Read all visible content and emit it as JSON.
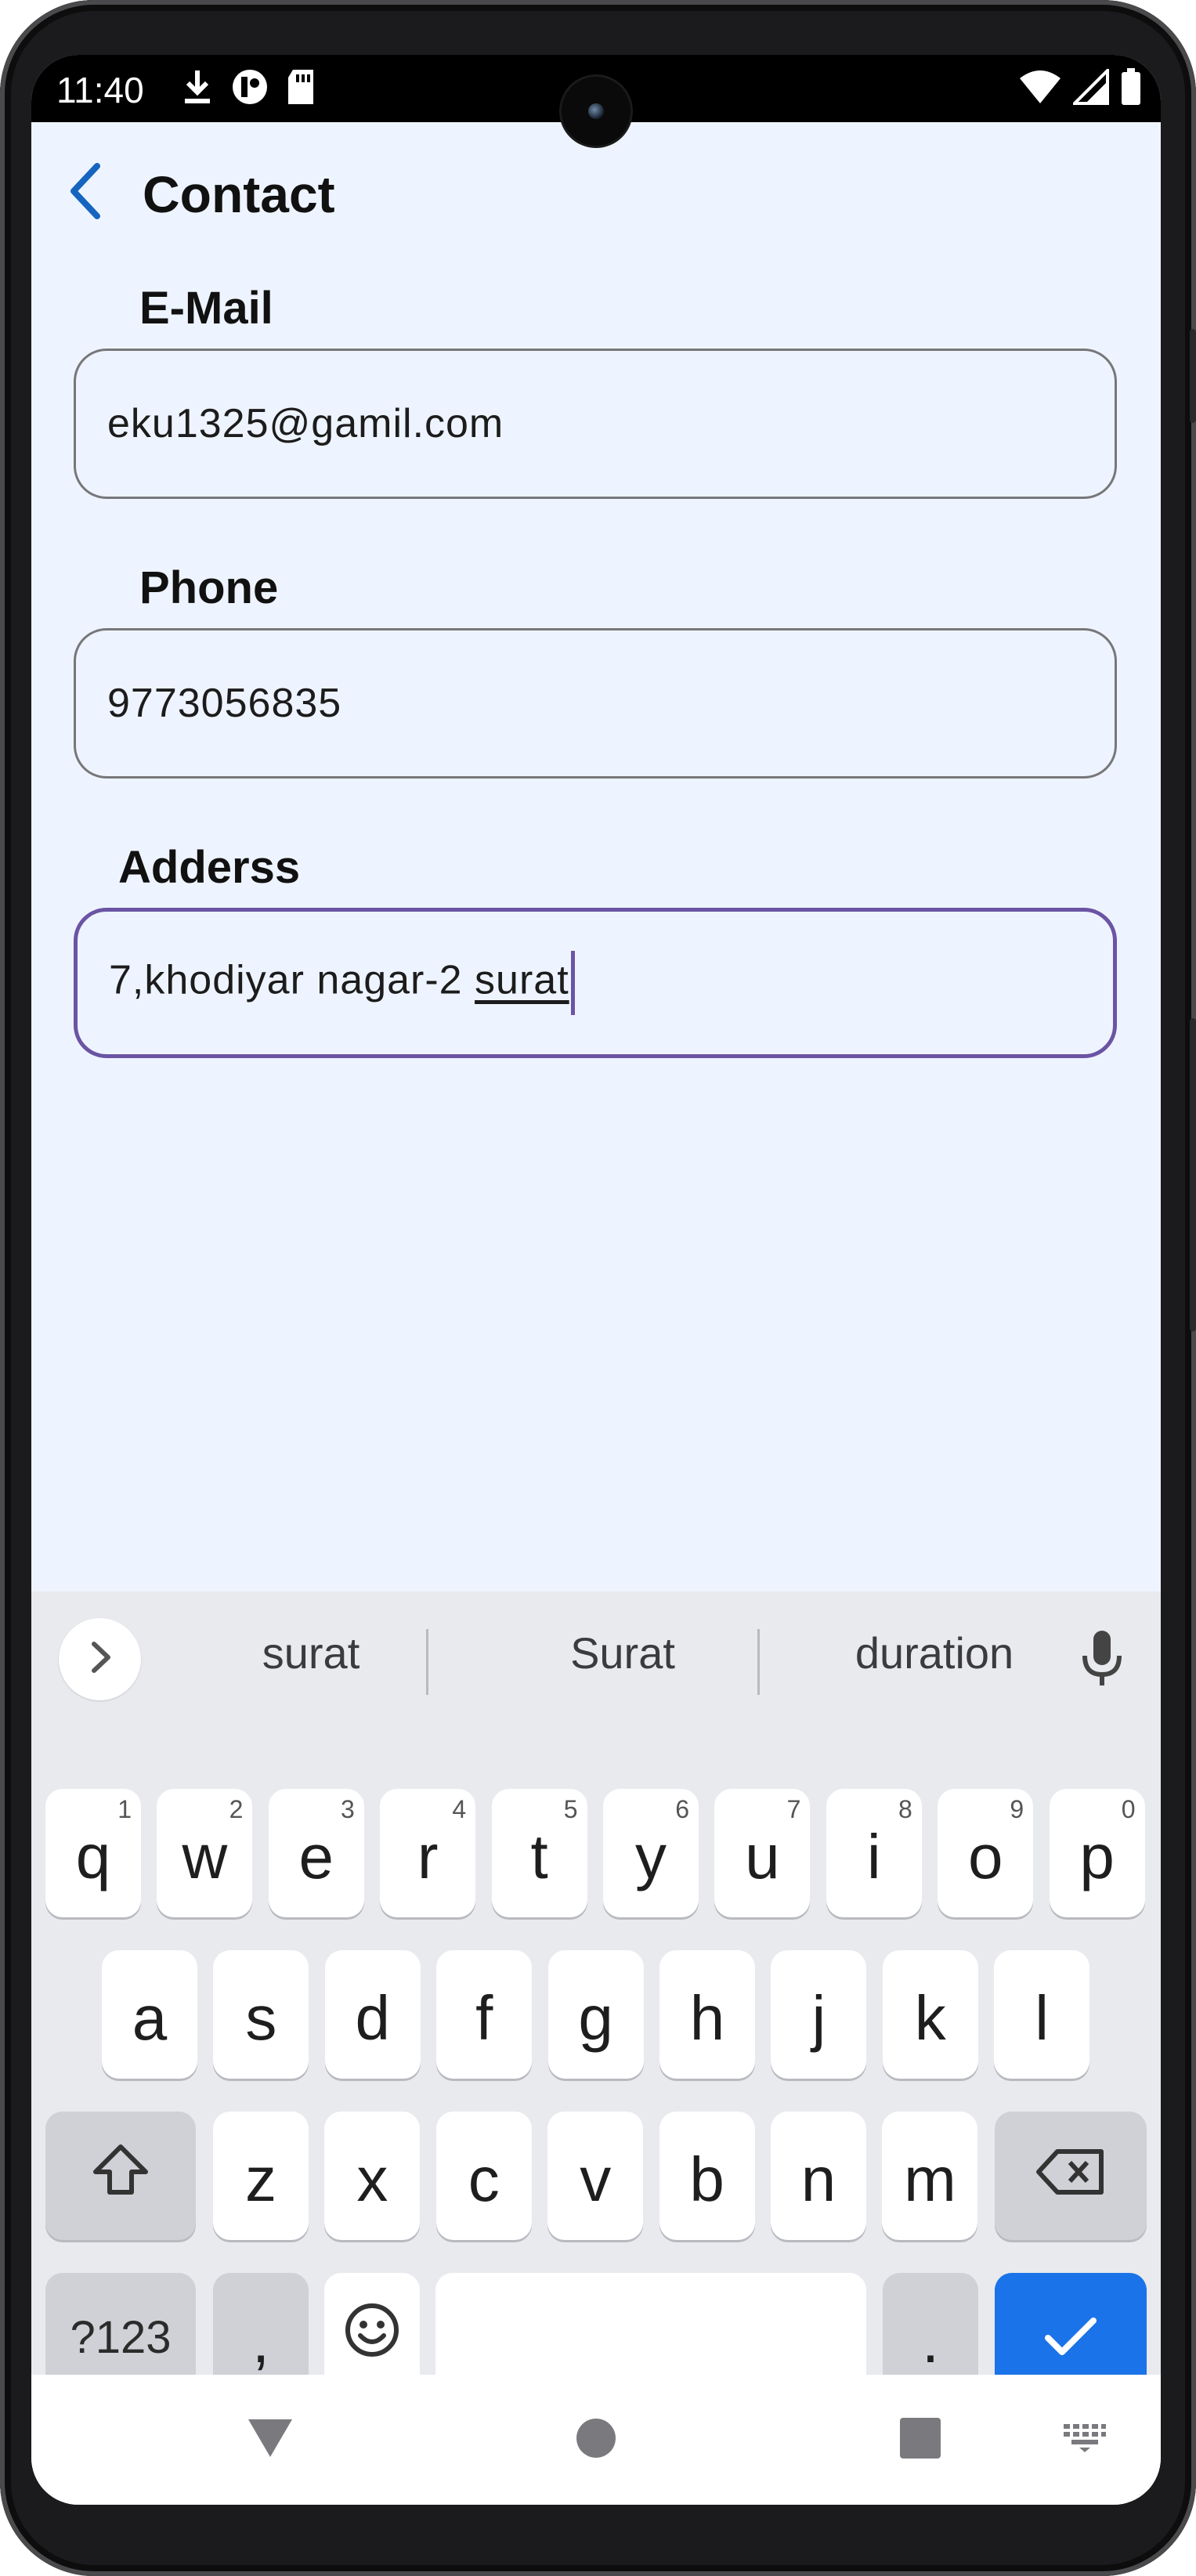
{
  "status_bar": {
    "time": "11:40",
    "left_icons": [
      "download-icon",
      "circle-app-icon",
      "sd-card-icon"
    ],
    "right_icons": [
      "wifi-icon",
      "signal-icon",
      "battery-icon"
    ]
  },
  "app_bar": {
    "back_icon": "chevron-left-icon",
    "title": "Contact",
    "accent_color": "#1565c0"
  },
  "form": {
    "email": {
      "label": "E-Mail",
      "value": "eku1325@gamil.com"
    },
    "phone": {
      "label": "Phone",
      "value": "9773056835"
    },
    "address": {
      "label": "Adderss",
      "value_prefix": "7,khodiyar nagar-2 ",
      "value_composing": "surat",
      "focus_color": "#6b54a3"
    }
  },
  "keyboard": {
    "suggestions": [
      "surat",
      "Surat",
      "duration"
    ],
    "row1": [
      {
        "key": "q",
        "hint": "1"
      },
      {
        "key": "w",
        "hint": "2"
      },
      {
        "key": "e",
        "hint": "3"
      },
      {
        "key": "r",
        "hint": "4"
      },
      {
        "key": "t",
        "hint": "5"
      },
      {
        "key": "y",
        "hint": "6"
      },
      {
        "key": "u",
        "hint": "7"
      },
      {
        "key": "i",
        "hint": "8"
      },
      {
        "key": "o",
        "hint": "9"
      },
      {
        "key": "p",
        "hint": "0"
      }
    ],
    "row2": [
      "a",
      "s",
      "d",
      "f",
      "g",
      "h",
      "j",
      "k",
      "l"
    ],
    "row3": [
      "z",
      "x",
      "c",
      "v",
      "b",
      "n",
      "m"
    ],
    "symbols_label": "?123",
    "comma": ",",
    "period": ".",
    "enter_color": "#1a73e8"
  },
  "nav_bar": {
    "icons": [
      "back-triangle-icon",
      "home-circle-icon",
      "recents-square-icon",
      "keyboard-switch-icon"
    ]
  }
}
